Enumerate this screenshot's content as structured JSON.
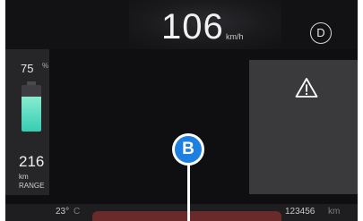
{
  "speed": {
    "value": "106",
    "unit": "km/h"
  },
  "gear": {
    "label": "D"
  },
  "battery": {
    "percent": "75",
    "percent_sign": "%",
    "level_fraction": 0.75,
    "fill_color": "#4fd9be"
  },
  "range": {
    "value": "216",
    "unit": "km",
    "label": "RANGE"
  },
  "warning": {
    "icon": "warning-triangle-icon"
  },
  "marker": {
    "label": "B",
    "color": "#1d7fe0"
  },
  "bottom_bar": {
    "temperature": "23°",
    "temperature_unit": "C",
    "odometer": "123456",
    "odometer_unit": "km",
    "alert_color": "#6b2a2a"
  }
}
